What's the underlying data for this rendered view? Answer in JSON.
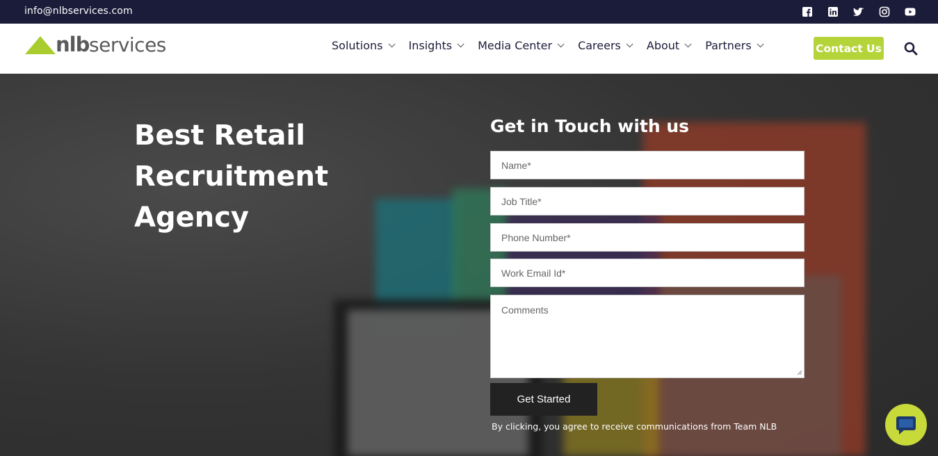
{
  "topbar": {
    "email": "info@nlbservices.com",
    "social_icons": [
      "facebook-icon",
      "linkedin-icon",
      "twitter-icon",
      "instagram-icon",
      "youtube-icon"
    ]
  },
  "header": {
    "logo": {
      "part1": "nlb",
      "part2": "services"
    },
    "nav": [
      {
        "label": "Solutions"
      },
      {
        "label": "Insights"
      },
      {
        "label": "Media Center"
      },
      {
        "label": "Careers"
      },
      {
        "label": "About"
      },
      {
        "label": "Partners"
      }
    ],
    "contact_label": "Contact Us",
    "search_icon": "search-icon"
  },
  "hero": {
    "title_line1": "Best Retail",
    "title_line2": "Recruitment",
    "title_line3": "Agency"
  },
  "form": {
    "title": "Get in Touch with us",
    "name_placeholder": "Name*",
    "job_title_placeholder": "Job Title*",
    "phone_placeholder": "Phone Number*",
    "email_placeholder": "Work Email Id*",
    "comments_placeholder": "Comments",
    "submit_label": "Get Started",
    "consent_text": "By clicking, you agree to receive communications from Team NLB"
  },
  "chat": {
    "icon": "chat-icon"
  },
  "colors": {
    "topbar_bg": "#1b1b3a",
    "accent_green": "#b5d43a",
    "nav_text": "#1b1b3a",
    "submit_bg": "#222222"
  }
}
